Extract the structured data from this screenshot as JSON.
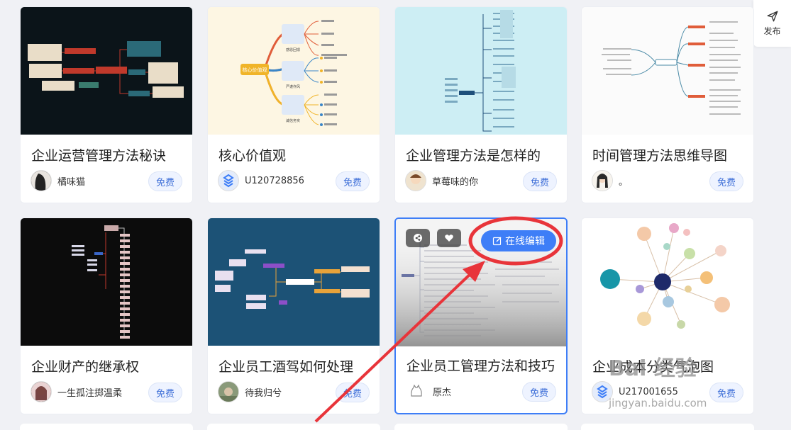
{
  "publish": {
    "label": "发布",
    "icon": "send-icon"
  },
  "cards": [
    {
      "title": "企业运营管理方法秘诀",
      "author": "橘味猫",
      "badge": "免费"
    },
    {
      "title": "核心价值观",
      "author": "U120728856",
      "badge": "免费",
      "thumb_text": {
        "core": "核心价值观",
        "n1": "感恩回馈",
        "n2": "严谨作风",
        "n3": "诚信务实"
      }
    },
    {
      "title": "企业管理方法是怎样的",
      "author": "草莓味的你",
      "badge": "免费"
    },
    {
      "title": "时间管理方法思维导图",
      "author": "。",
      "badge": "免费"
    },
    {
      "title": "企业财产的继承权",
      "author": "一生孤注掷温柔",
      "badge": "免费"
    },
    {
      "title": "企业员工酒驾如何处理",
      "author": "待我归兮",
      "badge": "免费"
    },
    {
      "title": "企业员工管理方法和技巧",
      "author": "原杰",
      "badge": "免费",
      "edit_label": "在线编辑"
    },
    {
      "title": "企业成本分类气泡图",
      "author": "U217001655",
      "badge": "免费"
    }
  ],
  "watermark": {
    "text": "Bai 经验",
    "sub": "jingyan.baidu.com"
  },
  "colors": {
    "accent": "#3e7ef7",
    "annotation": "#e8343a"
  }
}
